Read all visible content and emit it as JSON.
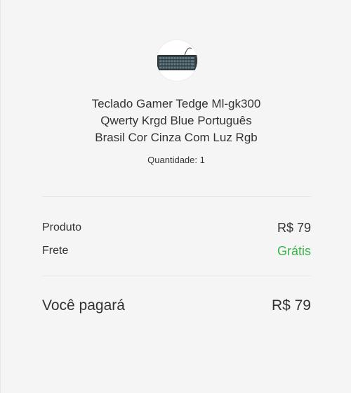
{
  "product": {
    "image_icon": "keyboard-image",
    "title_lines": [
      "Teclado Gamer Tedge Ml-gk300",
      "Qwerty Krgd Blue Português",
      "Brasil Cor Cinza Com Luz Rgb"
    ],
    "quantity_text": "Quantidade: 1"
  },
  "summary": {
    "product_label": "Produto",
    "product_value": "R$ 79",
    "shipping_label": "Frete",
    "shipping_value": "Grátis",
    "shipping_color": "#39b54a",
    "total_label": "Você pagará",
    "total_value": "R$ 79"
  }
}
